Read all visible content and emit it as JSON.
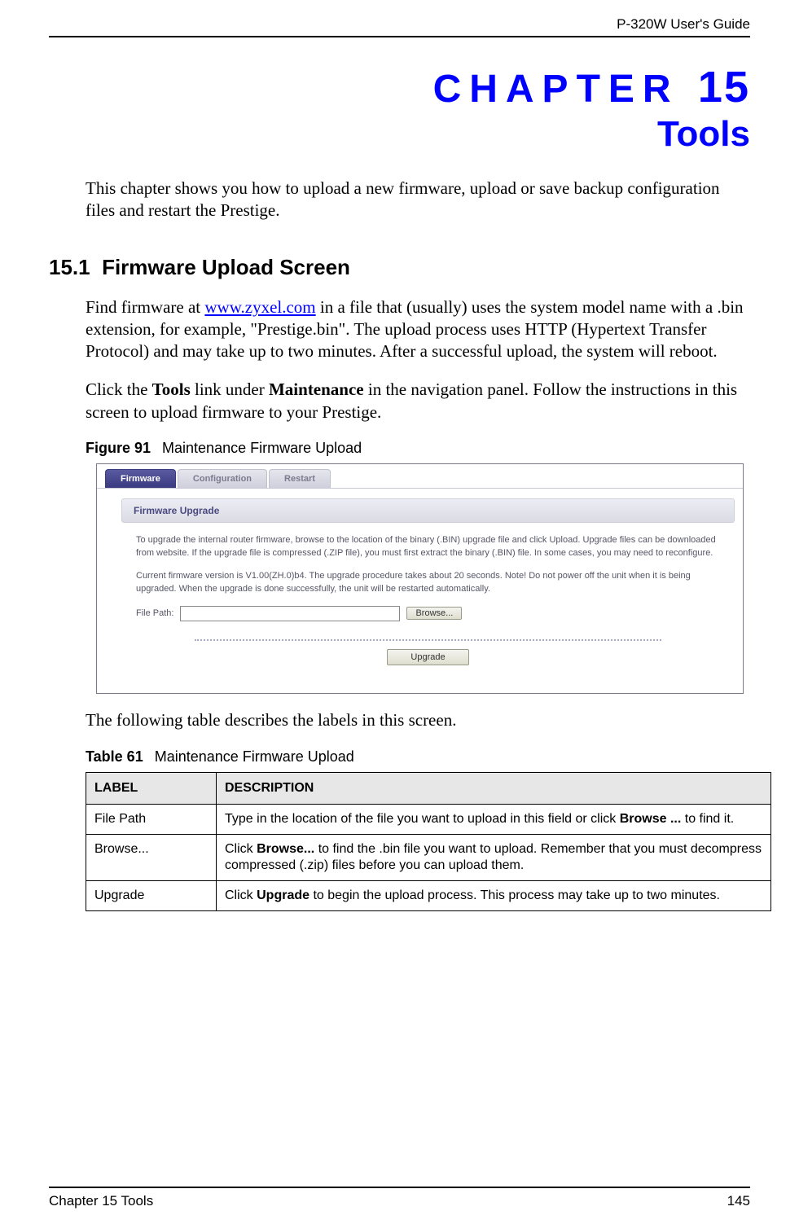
{
  "header": {
    "guide": "P-320W User's Guide"
  },
  "chapter": {
    "label": "CHAPTER",
    "number": "15",
    "title": "Tools"
  },
  "intro": "This chapter shows you how to upload a new firmware, upload or save backup configuration files and restart the Prestige.",
  "section": {
    "number": "15.1",
    "title": "Firmware Upload Screen"
  },
  "para1_a": "Find firmware at ",
  "para1_link": "www.zyxel.com",
  "para1_b": " in a file that (usually) uses the system model name with a .bin extension, for example, \"Prestige.bin\". The upload process uses HTTP (Hypertext Transfer Protocol) and may take up to two minutes. After a successful upload, the system will reboot.",
  "para2_a": "Click the ",
  "para2_bold1": "Tools",
  "para2_b": " link under ",
  "para2_bold2": "Maintenance",
  "para2_c": " in the navigation panel. Follow the instructions in this screen to upload firmware to your Prestige.",
  "figure": {
    "num": "Figure 91",
    "caption": "Maintenance Firmware Upload"
  },
  "screenshot": {
    "tabs": [
      "Firmware",
      "Configuration",
      "Restart"
    ],
    "panel_title": "Firmware Upgrade",
    "text1": "To upgrade the internal router firmware, browse to the location of the binary (.BIN) upgrade file and click Upload. Upgrade files can be downloaded from website. If the upgrade file is compressed (.ZIP file), you must first extract the binary (.BIN) file. In some cases, you may need to reconfigure.",
    "text2": "Current firmware version is V1.00(ZH.0)b4. The upgrade procedure takes about 20 seconds. Note! Do not power off the unit when it is being upgraded. When the upgrade is done successfully, the unit will be restarted automatically.",
    "file_label": "File Path:",
    "file_value": "",
    "browse": "Browse...",
    "upgrade": "Upgrade"
  },
  "after_figure": "The following table describes the labels in this screen.",
  "table": {
    "num": "Table 61",
    "caption": "Maintenance Firmware Upload",
    "headers": [
      "LABEL",
      "DESCRIPTION"
    ],
    "rows": [
      {
        "label": "File Path",
        "pre": "Type in the location of the file you want to upload in this field or click ",
        "bold": "Browse ...",
        "post": " to find it."
      },
      {
        "label": "Browse...",
        "pre": "Click ",
        "bold": "Browse...",
        "post": " to find the .bin file you want to upload. Remember that you must decompress compressed (.zip) files before you can upload them."
      },
      {
        "label": "Upgrade",
        "pre": "Click ",
        "bold": "Upgrade",
        "post": " to begin the upload process. This process may take up to two minutes."
      }
    ]
  },
  "footer": {
    "left": "Chapter 15 Tools",
    "right": "145"
  }
}
